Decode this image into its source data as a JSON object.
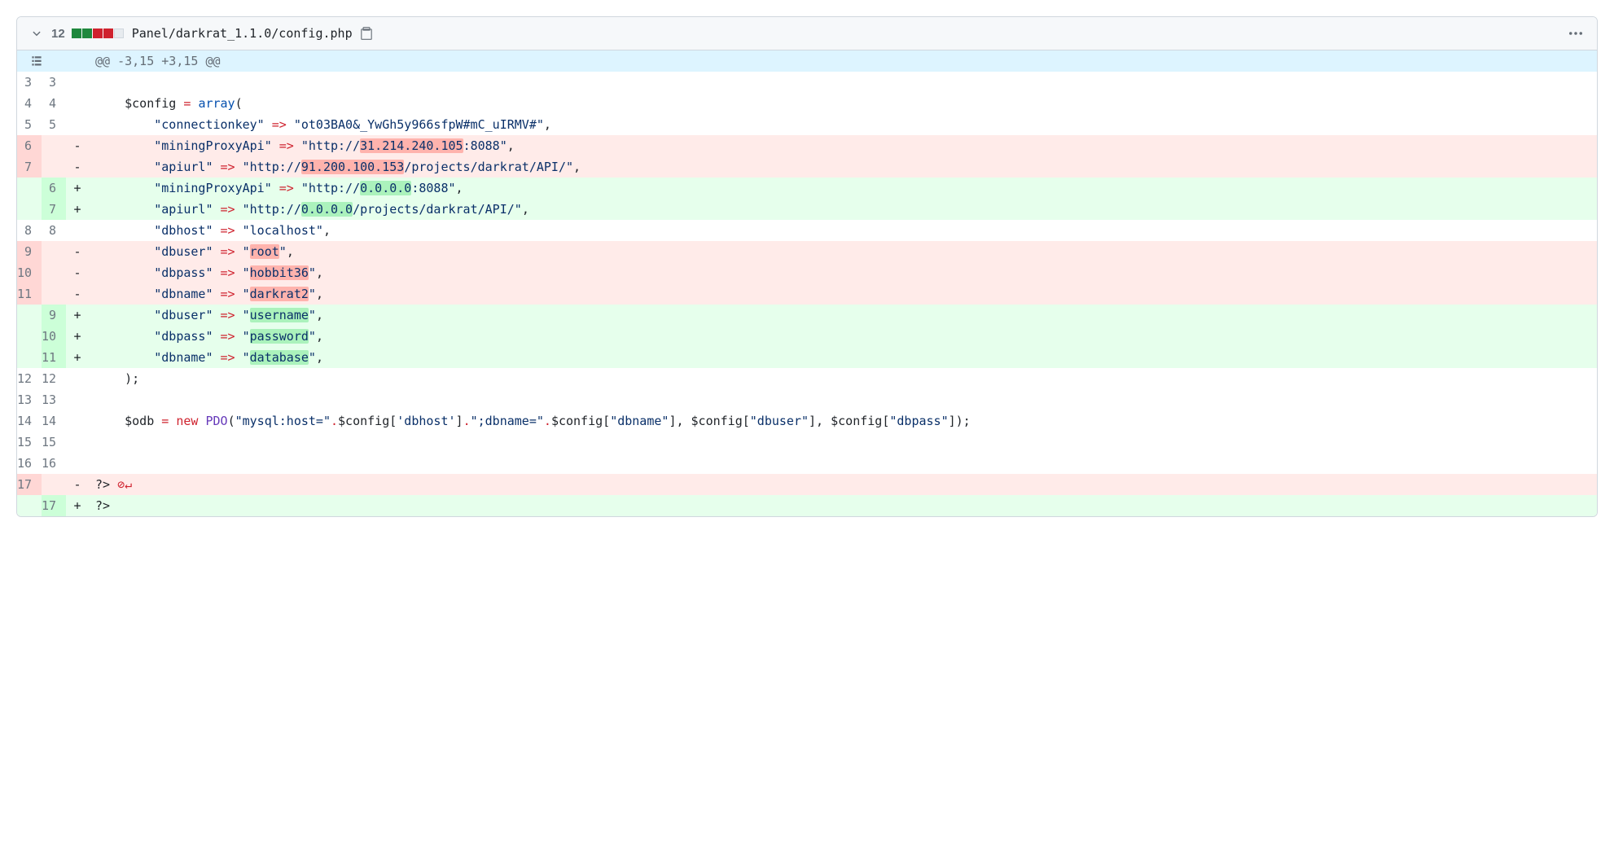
{
  "header": {
    "change_count": "12",
    "file_path": "Panel/darkrat_1.1.0/config.php"
  },
  "hunk": "@@ -3,15 +3,15 @@",
  "rows": [
    {
      "t": "ctx",
      "l": "3",
      "r": "3",
      "code": ""
    },
    {
      "t": "ctx",
      "l": "4",
      "r": "4",
      "segs": [
        {
          "txt": "    $config ",
          "c": "tok-var"
        },
        {
          "txt": "=",
          "c": "tok-op"
        },
        {
          "txt": " "
        },
        {
          "txt": "array",
          "c": "tok-kw"
        },
        {
          "txt": "("
        }
      ]
    },
    {
      "t": "ctx",
      "l": "5",
      "r": "5",
      "segs": [
        {
          "txt": "        "
        },
        {
          "txt": "\"connectionkey\"",
          "c": "tok-str"
        },
        {
          "txt": " "
        },
        {
          "txt": "=>",
          "c": "tok-op"
        },
        {
          "txt": " "
        },
        {
          "txt": "\"ot03BA0&_YwGh5y966sfpW#mC_uIRMV#\"",
          "c": "tok-str"
        },
        {
          "txt": ","
        }
      ]
    },
    {
      "t": "del",
      "l": "6",
      "r": "",
      "segs": [
        {
          "txt": "        "
        },
        {
          "txt": "\"miningProxyApi\"",
          "c": "tok-str"
        },
        {
          "txt": " "
        },
        {
          "txt": "=>",
          "c": "tok-op"
        },
        {
          "txt": " "
        },
        {
          "txt": "\"http://",
          "c": "tok-str"
        },
        {
          "txt": "31.214.240.105",
          "c": "tok-str hl-del"
        },
        {
          "txt": ":8088\"",
          "c": "tok-str"
        },
        {
          "txt": ","
        }
      ]
    },
    {
      "t": "del",
      "l": "7",
      "r": "",
      "segs": [
        {
          "txt": "        "
        },
        {
          "txt": "\"apiurl\"",
          "c": "tok-str"
        },
        {
          "txt": " "
        },
        {
          "txt": "=>",
          "c": "tok-op"
        },
        {
          "txt": " "
        },
        {
          "txt": "\"http://",
          "c": "tok-str"
        },
        {
          "txt": "91.200.100.153",
          "c": "tok-str hl-del"
        },
        {
          "txt": "/projects/darkrat/API/\"",
          "c": "tok-str"
        },
        {
          "txt": ","
        }
      ]
    },
    {
      "t": "add",
      "l": "",
      "r": "6",
      "segs": [
        {
          "txt": "        "
        },
        {
          "txt": "\"miningProxyApi\"",
          "c": "tok-str"
        },
        {
          "txt": " "
        },
        {
          "txt": "=>",
          "c": "tok-op"
        },
        {
          "txt": " "
        },
        {
          "txt": "\"http://",
          "c": "tok-str"
        },
        {
          "txt": "0.0.0.0",
          "c": "tok-str hl-add"
        },
        {
          "txt": ":8088\"",
          "c": "tok-str"
        },
        {
          "txt": ","
        }
      ]
    },
    {
      "t": "add",
      "l": "",
      "r": "7",
      "segs": [
        {
          "txt": "        "
        },
        {
          "txt": "\"apiurl\"",
          "c": "tok-str"
        },
        {
          "txt": " "
        },
        {
          "txt": "=>",
          "c": "tok-op"
        },
        {
          "txt": " "
        },
        {
          "txt": "\"http://",
          "c": "tok-str"
        },
        {
          "txt": "0.0.0.0",
          "c": "tok-str hl-add"
        },
        {
          "txt": "/projects/darkrat/API/\"",
          "c": "tok-str"
        },
        {
          "txt": ","
        }
      ]
    },
    {
      "t": "ctx",
      "l": "8",
      "r": "8",
      "segs": [
        {
          "txt": "        "
        },
        {
          "txt": "\"dbhost\"",
          "c": "tok-str"
        },
        {
          "txt": " "
        },
        {
          "txt": "=>",
          "c": "tok-op"
        },
        {
          "txt": " "
        },
        {
          "txt": "\"localhost\"",
          "c": "tok-str"
        },
        {
          "txt": ","
        }
      ]
    },
    {
      "t": "del",
      "l": "9",
      "r": "",
      "segs": [
        {
          "txt": "        "
        },
        {
          "txt": "\"dbuser\"",
          "c": "tok-str"
        },
        {
          "txt": " "
        },
        {
          "txt": "=>",
          "c": "tok-op"
        },
        {
          "txt": " "
        },
        {
          "txt": "\"",
          "c": "tok-str"
        },
        {
          "txt": "root",
          "c": "tok-str hl-del"
        },
        {
          "txt": "\"",
          "c": "tok-str"
        },
        {
          "txt": ","
        }
      ]
    },
    {
      "t": "del",
      "l": "10",
      "r": "",
      "segs": [
        {
          "txt": "        "
        },
        {
          "txt": "\"dbpass\"",
          "c": "tok-str"
        },
        {
          "txt": " "
        },
        {
          "txt": "=>",
          "c": "tok-op"
        },
        {
          "txt": " "
        },
        {
          "txt": "\"",
          "c": "tok-str"
        },
        {
          "txt": "hobbit36",
          "c": "tok-str hl-del"
        },
        {
          "txt": "\"",
          "c": "tok-str"
        },
        {
          "txt": ","
        }
      ]
    },
    {
      "t": "del",
      "l": "11",
      "r": "",
      "segs": [
        {
          "txt": "        "
        },
        {
          "txt": "\"dbname\"",
          "c": "tok-str"
        },
        {
          "txt": " "
        },
        {
          "txt": "=>",
          "c": "tok-op"
        },
        {
          "txt": " "
        },
        {
          "txt": "\"",
          "c": "tok-str"
        },
        {
          "txt": "darkrat2",
          "c": "tok-str hl-del"
        },
        {
          "txt": "\"",
          "c": "tok-str"
        },
        {
          "txt": ","
        }
      ]
    },
    {
      "t": "add",
      "l": "",
      "r": "9",
      "segs": [
        {
          "txt": "        "
        },
        {
          "txt": "\"dbuser\"",
          "c": "tok-str"
        },
        {
          "txt": " "
        },
        {
          "txt": "=>",
          "c": "tok-op"
        },
        {
          "txt": " "
        },
        {
          "txt": "\"",
          "c": "tok-str"
        },
        {
          "txt": "username",
          "c": "tok-str hl-add"
        },
        {
          "txt": "\"",
          "c": "tok-str"
        },
        {
          "txt": ","
        }
      ]
    },
    {
      "t": "add",
      "l": "",
      "r": "10",
      "segs": [
        {
          "txt": "        "
        },
        {
          "txt": "\"dbpass\"",
          "c": "tok-str"
        },
        {
          "txt": " "
        },
        {
          "txt": "=>",
          "c": "tok-op"
        },
        {
          "txt": " "
        },
        {
          "txt": "\"",
          "c": "tok-str"
        },
        {
          "txt": "password",
          "c": "tok-str hl-add"
        },
        {
          "txt": "\"",
          "c": "tok-str"
        },
        {
          "txt": ","
        }
      ]
    },
    {
      "t": "add",
      "l": "",
      "r": "11",
      "segs": [
        {
          "txt": "        "
        },
        {
          "txt": "\"dbname\"",
          "c": "tok-str"
        },
        {
          "txt": " "
        },
        {
          "txt": "=>",
          "c": "tok-op"
        },
        {
          "txt": " "
        },
        {
          "txt": "\"",
          "c": "tok-str"
        },
        {
          "txt": "database",
          "c": "tok-str hl-add"
        },
        {
          "txt": "\"",
          "c": "tok-str"
        },
        {
          "txt": ","
        }
      ]
    },
    {
      "t": "ctx",
      "l": "12",
      "r": "12",
      "segs": [
        {
          "txt": "    );"
        }
      ]
    },
    {
      "t": "ctx",
      "l": "13",
      "r": "13",
      "code": ""
    },
    {
      "t": "ctx",
      "l": "14",
      "r": "14",
      "segs": [
        {
          "txt": "    $odb ",
          "c": "tok-var"
        },
        {
          "txt": "=",
          "c": "tok-op"
        },
        {
          "txt": " "
        },
        {
          "txt": "new",
          "c": "tok-new"
        },
        {
          "txt": " "
        },
        {
          "txt": "PDO",
          "c": "tok-fn"
        },
        {
          "txt": "("
        },
        {
          "txt": "\"mysql:host=\"",
          "c": "tok-str"
        },
        {
          "txt": ".",
          "c": "tok-op"
        },
        {
          "txt": "$config",
          "c": "tok-var"
        },
        {
          "txt": "["
        },
        {
          "txt": "'dbhost'",
          "c": "tok-str"
        },
        {
          "txt": "]"
        },
        {
          "txt": ".",
          "c": "tok-op"
        },
        {
          "txt": "\";dbname=\"",
          "c": "tok-str"
        },
        {
          "txt": ".",
          "c": "tok-op"
        },
        {
          "txt": "$config",
          "c": "tok-var"
        },
        {
          "txt": "["
        },
        {
          "txt": "\"dbname\"",
          "c": "tok-str"
        },
        {
          "txt": "], $config["
        },
        {
          "txt": "\"dbuser\"",
          "c": "tok-str"
        },
        {
          "txt": "], $config["
        },
        {
          "txt": "\"dbpass\"",
          "c": "tok-str"
        },
        {
          "txt": "]);"
        }
      ]
    },
    {
      "t": "ctx",
      "l": "15",
      "r": "15",
      "code": ""
    },
    {
      "t": "ctx",
      "l": "16",
      "r": "16",
      "code": ""
    },
    {
      "t": "del",
      "l": "17",
      "r": "",
      "segs": [
        {
          "txt": "?> "
        },
        {
          "txt": "⊘↵",
          "c": "nnl-icon"
        }
      ]
    },
    {
      "t": "add",
      "l": "",
      "r": "17",
      "segs": [
        {
          "txt": "?>"
        }
      ]
    }
  ]
}
